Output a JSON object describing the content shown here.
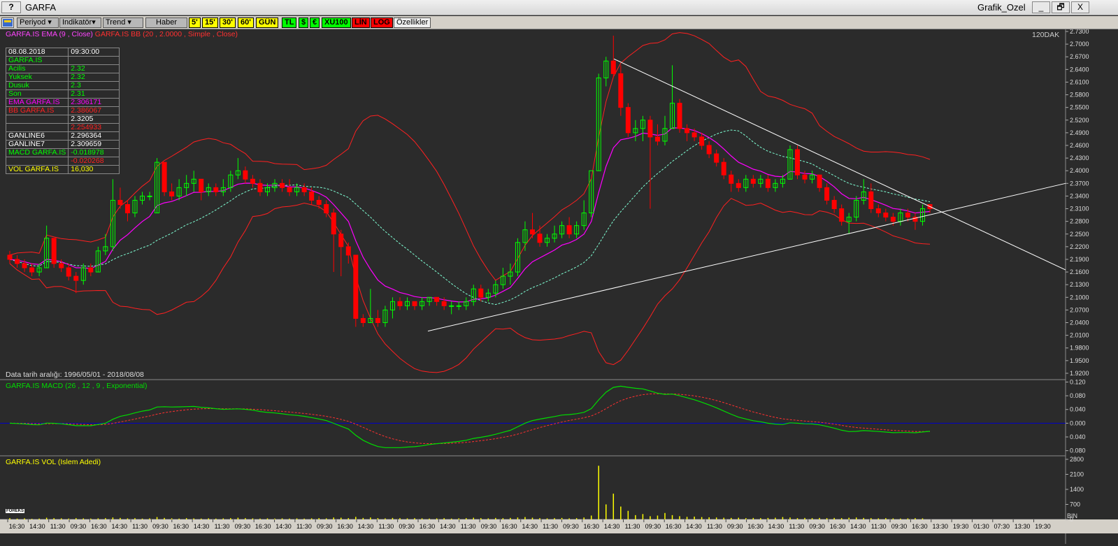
{
  "window": {
    "help_label": "?",
    "title": "GARFA",
    "right_title": "Grafik_Ozel",
    "minimize": "_",
    "restore": "🗗",
    "close": "X"
  },
  "toolbar": {
    "periyod": "Periyod",
    "indikator": "Indikatör",
    "trend": "Trend",
    "haber": "Haber",
    "p5": "5'",
    "p15": "15'",
    "p30": "30'",
    "p60": "60'",
    "gun": "GÜN",
    "tl": "TL",
    "usd": "$",
    "eur": "€",
    "xu100": "XU100",
    "lin": "LİN",
    "log": "LOG",
    "ozellikler": "Özellikler"
  },
  "legends": {
    "ema": "GARFA.IS EMA (9 , Close)",
    "bb": "GARFA.IS BB (20 , 2.0000 , Simple , Close)",
    "period": "120DAK",
    "date_range": "Data tarih aralığı: 1996/05/01 - 2018/08/08",
    "macd": "GARFA.IS MACD (26 , 12 , 9 , Exponential)",
    "vol": "GARFA.IS VOL (Islem Adedi)",
    "bin": "BIN",
    "foreks": "FOREKS"
  },
  "infobox": [
    {
      "k": "08.08.2018",
      "v": "09:30:00",
      "kc": "#ffffff",
      "vc": "#ffffff"
    },
    {
      "k": "GARFA.IS",
      "v": "",
      "kc": "#00ff00",
      "vc": "#00ff00"
    },
    {
      "k": "  Acilis",
      "v": "2.32",
      "kc": "#00ff00",
      "vc": "#00ff00"
    },
    {
      "k": "  Yuksek",
      "v": "2.32",
      "kc": "#00ff00",
      "vc": "#00ff00"
    },
    {
      "k": "  Dusuk",
      "v": "2.3",
      "kc": "#00ff00",
      "vc": "#00ff00"
    },
    {
      "k": "  Son",
      "v": "2.31",
      "kc": "#00ff00",
      "vc": "#00ff00"
    },
    {
      "k": "EMA GARFA.IS",
      "v": "2.306171",
      "kc": "#ff00ff",
      "vc": "#ff00ff"
    },
    {
      "k": "BB GARFA.IS",
      "v": "2.386067",
      "kc": "#ff2020",
      "vc": "#ff2020"
    },
    {
      "k": "",
      "v": "2.3205",
      "kc": "#ffffff",
      "vc": "#ffffff"
    },
    {
      "k": "",
      "v": "2.254933",
      "kc": "#ff2020",
      "vc": "#ff2020"
    },
    {
      "k": "GANLINE6",
      "v": "2.296364",
      "kc": "#ffffff",
      "vc": "#ffffff"
    },
    {
      "k": "GANLINE7",
      "v": "2.309659",
      "kc": "#ffffff",
      "vc": "#ffffff"
    },
    {
      "k": "MACD GARFA.IS",
      "v": "-0.018978",
      "kc": "#00ff00",
      "vc": "#00ff00"
    },
    {
      "k": "",
      "v": "-0.020268",
      "kc": "#ff2020",
      "vc": "#ff2020"
    },
    {
      "k": "VOL GARFA.IS",
      "v": "16,030",
      "kc": "#ffff00",
      "vc": "#ffff00"
    }
  ],
  "colors": {
    "up": "#00ff00",
    "down": "#ff0000",
    "ema": "#ff00ff",
    "bb": "#ff2020",
    "bb_mid": "#7fffd4",
    "macd": "#00dd00",
    "signal": "#ff3030",
    "vol": "#ffff00",
    "trend": "#ffffff",
    "zero": "#0000cc"
  },
  "chart_data": {
    "type": "candlestick",
    "price_ticks": [
      "2.7300",
      "2.7000",
      "2.6700",
      "2.6400",
      "2.6100",
      "2.5800",
      "2.5500",
      "2.5200",
      "2.4900",
      "2.4600",
      "2.4300",
      "2.4000",
      "2.3700",
      "2.3400",
      "2.3100",
      "2.2800",
      "2.2500",
      "2.2200",
      "2.1900",
      "2.1600",
      "2.1300",
      "2.1000",
      "2.0700",
      "2.0400",
      "2.0100",
      "1.9800",
      "1.9500",
      "1.9200"
    ],
    "price_range": [
      1.905,
      2.735
    ],
    "macd_ticks": [
      "0.120",
      "0.080",
      "0.040",
      "0.000",
      "0.040",
      "0.080"
    ],
    "macd_range": [
      -0.095,
      0.125
    ],
    "vol_ticks": [
      "2800",
      "2100",
      "1400",
      "700",
      "0"
    ],
    "vol_range": [
      0,
      2800
    ],
    "time_labels": [
      "16:30",
      "14:30",
      "11:30",
      "09:30",
      "16:30",
      "14:30",
      "11:30",
      "09:30",
      "16:30",
      "14:30",
      "11:30",
      "09:30",
      "16:30",
      "14:30",
      "11:30",
      "09:30",
      "16:30",
      "14:30",
      "11:30",
      "09:30",
      "16:30",
      "14:30",
      "11:30",
      "09:30",
      "16:30",
      "14:30",
      "11:30",
      "09:30",
      "16:30",
      "14:30",
      "11:30",
      "09:30",
      "16:30",
      "14:30",
      "11:30",
      "09:30",
      "16:30",
      "14:30",
      "11:30",
      "09:30",
      "16:30",
      "14:30",
      "11:30",
      "09:30",
      "16:30",
      "13:30",
      "19:30",
      "01:30",
      "07:30",
      "13:30",
      "19:30"
    ],
    "ohlc": [
      [
        2.2,
        2.21,
        2.18,
        2.19
      ],
      [
        2.19,
        2.2,
        2.17,
        2.18
      ],
      [
        2.18,
        2.19,
        2.16,
        2.17
      ],
      [
        2.17,
        2.18,
        2.15,
        2.16
      ],
      [
        2.16,
        2.18,
        2.15,
        2.17
      ],
      [
        2.17,
        2.27,
        2.17,
        2.24
      ],
      [
        2.24,
        2.24,
        2.17,
        2.18
      ],
      [
        2.18,
        2.19,
        2.16,
        2.17
      ],
      [
        2.17,
        2.18,
        2.14,
        2.15
      ],
      [
        2.15,
        2.16,
        2.11,
        2.14
      ],
      [
        2.14,
        2.18,
        2.13,
        2.17
      ],
      [
        2.17,
        2.18,
        2.15,
        2.16
      ],
      [
        2.16,
        2.22,
        2.16,
        2.21
      ],
      [
        2.21,
        2.25,
        2.2,
        2.22
      ],
      [
        2.22,
        2.38,
        2.21,
        2.33
      ],
      [
        2.33,
        2.36,
        2.31,
        2.32
      ],
      [
        2.32,
        2.33,
        2.28,
        2.3
      ],
      [
        2.3,
        2.34,
        2.29,
        2.33
      ],
      [
        2.33,
        2.35,
        2.32,
        2.34
      ],
      [
        2.34,
        2.35,
        2.33,
        2.34
      ],
      [
        2.3,
        2.43,
        2.3,
        2.42
      ],
      [
        2.42,
        2.42,
        2.34,
        2.35
      ],
      [
        2.35,
        2.37,
        2.33,
        2.34
      ],
      [
        2.34,
        2.38,
        2.33,
        2.36
      ],
      [
        2.36,
        2.39,
        2.34,
        2.37
      ],
      [
        2.37,
        2.4,
        2.35,
        2.38
      ],
      [
        2.38,
        2.38,
        2.33,
        2.35
      ],
      [
        2.35,
        2.37,
        2.34,
        2.36
      ],
      [
        2.36,
        2.37,
        2.34,
        2.35
      ],
      [
        2.35,
        2.38,
        2.34,
        2.36
      ],
      [
        2.36,
        2.4,
        2.35,
        2.39
      ],
      [
        2.39,
        2.43,
        2.38,
        2.4
      ],
      [
        2.4,
        2.41,
        2.37,
        2.38
      ],
      [
        2.38,
        2.39,
        2.36,
        2.37
      ],
      [
        2.37,
        2.38,
        2.34,
        2.35
      ],
      [
        2.35,
        2.37,
        2.34,
        2.36
      ],
      [
        2.36,
        2.38,
        2.35,
        2.37
      ],
      [
        2.37,
        2.38,
        2.35,
        2.36
      ],
      [
        2.36,
        2.38,
        2.34,
        2.35
      ],
      [
        2.35,
        2.37,
        2.34,
        2.36
      ],
      [
        2.36,
        2.37,
        2.34,
        2.35
      ],
      [
        2.35,
        2.36,
        2.32,
        2.33
      ],
      [
        2.33,
        2.34,
        2.31,
        2.32
      ],
      [
        2.32,
        2.33,
        2.29,
        2.3
      ],
      [
        2.3,
        2.31,
        2.16,
        2.25
      ],
      [
        2.25,
        2.26,
        2.15,
        2.22
      ],
      [
        2.22,
        2.23,
        2.18,
        2.2
      ],
      [
        2.2,
        2.2,
        2.03,
        2.05
      ],
      [
        2.05,
        2.06,
        2.03,
        2.04
      ],
      [
        2.04,
        2.12,
        2.04,
        2.05
      ],
      [
        2.05,
        2.07,
        2.03,
        2.04
      ],
      [
        2.04,
        2.08,
        2.03,
        2.07
      ],
      [
        2.07,
        2.1,
        2.05,
        2.09
      ],
      [
        2.09,
        2.1,
        2.07,
        2.08
      ],
      [
        2.08,
        2.1,
        2.07,
        2.09
      ],
      [
        2.09,
        2.09,
        2.07,
        2.08
      ],
      [
        2.08,
        2.1,
        2.07,
        2.09
      ],
      [
        2.09,
        2.1,
        2.08,
        2.1
      ],
      [
        2.1,
        2.1,
        2.08,
        2.09
      ],
      [
        2.09,
        2.1,
        2.07,
        2.08
      ],
      [
        2.08,
        2.09,
        2.06,
        2.08
      ],
      [
        2.08,
        2.09,
        2.07,
        2.08
      ],
      [
        2.08,
        2.1,
        2.07,
        2.09
      ],
      [
        2.09,
        2.13,
        2.08,
        2.12
      ],
      [
        2.12,
        2.13,
        2.09,
        2.1
      ],
      [
        2.1,
        2.12,
        2.09,
        2.11
      ],
      [
        2.11,
        2.14,
        2.1,
        2.13
      ],
      [
        2.13,
        2.17,
        2.12,
        2.15
      ],
      [
        2.15,
        2.18,
        2.13,
        2.16
      ],
      [
        2.16,
        2.24,
        2.15,
        2.23
      ],
      [
        2.23,
        2.28,
        2.21,
        2.26
      ],
      [
        2.26,
        2.3,
        2.24,
        2.25
      ],
      [
        2.25,
        2.27,
        2.22,
        2.23
      ],
      [
        2.23,
        2.25,
        2.22,
        2.24
      ],
      [
        2.24,
        2.27,
        2.23,
        2.25
      ],
      [
        2.25,
        2.28,
        2.24,
        2.27
      ],
      [
        2.27,
        2.29,
        2.24,
        2.25
      ],
      [
        2.25,
        2.28,
        2.24,
        2.27
      ],
      [
        2.27,
        2.33,
        2.26,
        2.3
      ],
      [
        2.3,
        2.38,
        2.29,
        2.4
      ],
      [
        2.4,
        2.63,
        2.4,
        2.62
      ],
      [
        2.62,
        2.67,
        2.6,
        2.66
      ],
      [
        2.66,
        2.72,
        2.62,
        2.63
      ],
      [
        2.63,
        2.65,
        2.53,
        2.55
      ],
      [
        2.55,
        2.56,
        2.48,
        2.49
      ],
      [
        2.49,
        2.52,
        2.47,
        2.5
      ],
      [
        2.5,
        2.53,
        2.47,
        2.52
      ],
      [
        2.52,
        2.53,
        2.31,
        2.48
      ],
      [
        2.48,
        2.51,
        2.46,
        2.47
      ],
      [
        2.47,
        2.53,
        2.46,
        2.5
      ],
      [
        2.5,
        2.65,
        2.5,
        2.56
      ],
      [
        2.56,
        2.57,
        2.49,
        2.5
      ],
      [
        2.5,
        2.51,
        2.47,
        2.49
      ],
      [
        2.49,
        2.5,
        2.47,
        2.48
      ],
      [
        2.48,
        2.49,
        2.45,
        2.46
      ],
      [
        2.46,
        2.47,
        2.43,
        2.44
      ],
      [
        2.44,
        2.45,
        2.41,
        2.42
      ],
      [
        2.42,
        2.43,
        2.38,
        2.39
      ],
      [
        2.39,
        2.4,
        2.35,
        2.37
      ],
      [
        2.37,
        2.38,
        2.35,
        2.36
      ],
      [
        2.36,
        2.39,
        2.35,
        2.38
      ],
      [
        2.38,
        2.39,
        2.36,
        2.37
      ],
      [
        2.37,
        2.39,
        2.36,
        2.38
      ],
      [
        2.38,
        2.39,
        2.35,
        2.36
      ],
      [
        2.36,
        2.38,
        2.35,
        2.37
      ],
      [
        2.37,
        2.39,
        2.36,
        2.38
      ],
      [
        2.38,
        2.46,
        2.38,
        2.45
      ],
      [
        2.45,
        2.46,
        2.38,
        2.39
      ],
      [
        2.39,
        2.4,
        2.37,
        2.38
      ],
      [
        2.38,
        2.4,
        2.37,
        2.39
      ],
      [
        2.39,
        2.39,
        2.35,
        2.36
      ],
      [
        2.36,
        2.37,
        2.32,
        2.33
      ],
      [
        2.33,
        2.34,
        2.3,
        2.31
      ],
      [
        2.31,
        2.32,
        2.27,
        2.28
      ],
      [
        2.28,
        2.3,
        2.25,
        2.29
      ],
      [
        2.29,
        2.34,
        2.28,
        2.33
      ],
      [
        2.33,
        2.38,
        2.32,
        2.35
      ],
      [
        2.35,
        2.37,
        2.3,
        2.31
      ],
      [
        2.31,
        2.32,
        2.29,
        2.3
      ],
      [
        2.3,
        2.31,
        2.28,
        2.29
      ],
      [
        2.29,
        2.3,
        2.27,
        2.28
      ],
      [
        2.28,
        2.31,
        2.27,
        2.3
      ],
      [
        2.3,
        2.31,
        2.28,
        2.29
      ],
      [
        2.29,
        2.3,
        2.26,
        2.28
      ],
      [
        2.28,
        2.32,
        2.27,
        2.31
      ],
      [
        2.32,
        2.32,
        2.3,
        2.31
      ]
    ],
    "volume": [
      60,
      40,
      50,
      30,
      40,
      80,
      60,
      50,
      40,
      60,
      50,
      40,
      50,
      60,
      90,
      70,
      50,
      60,
      40,
      50,
      110,
      70,
      50,
      40,
      60,
      50,
      40,
      50,
      40,
      50,
      60,
      80,
      60,
      50,
      40,
      50,
      40,
      50,
      40,
      50,
      40,
      50,
      60,
      50,
      90,
      80,
      60,
      120,
      70,
      90,
      60,
      50,
      70,
      60,
      50,
      60,
      50,
      40,
      50,
      60,
      40,
      50,
      60,
      80,
      60,
      50,
      70,
      60,
      70,
      90,
      110,
      80,
      60,
      50,
      60,
      70,
      50,
      60,
      90,
      180,
      2500,
      700,
      1200,
      600,
      400,
      200,
      250,
      150,
      180,
      300,
      200,
      150,
      120,
      130,
      110,
      100,
      90,
      80,
      70,
      80,
      60,
      70,
      60,
      70,
      80,
      110,
      90,
      60,
      70,
      60,
      70,
      60,
      70,
      60,
      80,
      90,
      70,
      60,
      50,
      60,
      50,
      40,
      50,
      60,
      50
    ]
  }
}
